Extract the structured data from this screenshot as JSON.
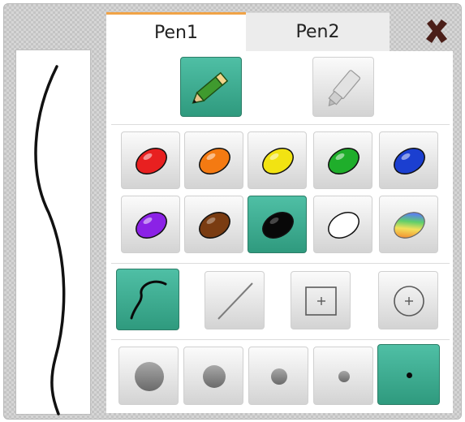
{
  "tabs": [
    {
      "label": "Pen1",
      "active": true
    },
    {
      "label": "Pen2",
      "active": false
    }
  ],
  "close_icon": "close-x-icon",
  "tools": [
    {
      "name": "pencil-icon",
      "active": true
    },
    {
      "name": "marker-icon",
      "active": false
    }
  ],
  "colors": [
    {
      "name": "red",
      "hex": "#e82020",
      "active": false
    },
    {
      "name": "orange",
      "hex": "#f47a12",
      "active": false
    },
    {
      "name": "yellow",
      "hex": "#f2e312",
      "active": false
    },
    {
      "name": "green",
      "hex": "#1fae2b",
      "active": false
    },
    {
      "name": "blue",
      "hex": "#1b3fd0",
      "active": false
    },
    {
      "name": "purple",
      "hex": "#8b22e6",
      "active": false
    },
    {
      "name": "brown",
      "hex": "#7a3c12",
      "active": false
    },
    {
      "name": "black",
      "hex": "#080808",
      "active": true
    },
    {
      "name": "white",
      "hex": "#ffffff",
      "active": false
    },
    {
      "name": "rainbow",
      "hex": "rainbow",
      "active": false
    }
  ],
  "shapes": [
    {
      "name": "freehand-icon",
      "active": true
    },
    {
      "name": "line-icon",
      "active": false
    },
    {
      "name": "rectangle-icon",
      "active": false
    },
    {
      "name": "circle-icon",
      "active": false
    }
  ],
  "sizes": [
    {
      "name": "size-extra-large",
      "active": false
    },
    {
      "name": "size-large",
      "active": false
    },
    {
      "name": "size-medium",
      "active": false
    },
    {
      "name": "size-small",
      "active": false
    },
    {
      "name": "size-extra-small",
      "active": true
    }
  ],
  "accent_color": "#36a98c",
  "tab_highlight_color": "#f0a347"
}
